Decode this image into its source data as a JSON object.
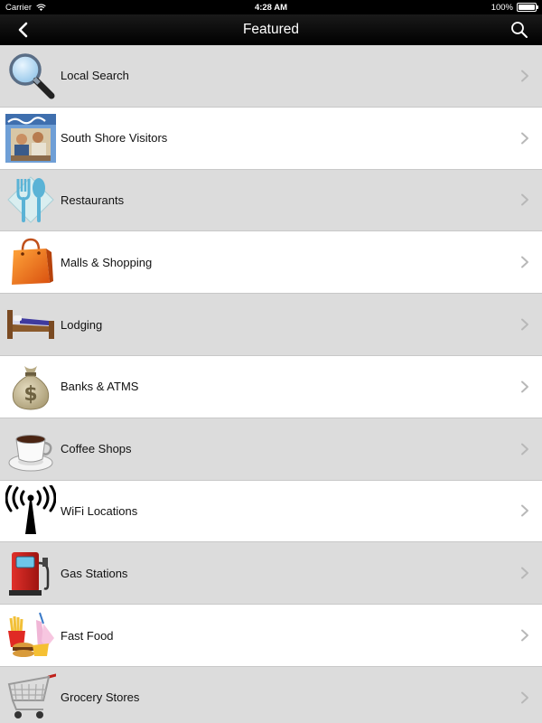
{
  "status": {
    "carrier": "Carrier",
    "time": "4:28 AM",
    "battery": "100%",
    "battery_level": 1.0
  },
  "nav": {
    "title": "Featured",
    "back_icon": "chevron-left-icon",
    "search_icon": "search-icon"
  },
  "items": [
    {
      "label": "Local Search",
      "icon": "magnifying-glass-icon"
    },
    {
      "label": "South Shore Visitors",
      "icon": "magazine-cover-icon"
    },
    {
      "label": "Restaurants",
      "icon": "fork-spoon-icon"
    },
    {
      "label": "Malls & Shopping",
      "icon": "shopping-bag-icon"
    },
    {
      "label": "Lodging",
      "icon": "bed-icon"
    },
    {
      "label": "Banks & ATMS",
      "icon": "money-bag-icon"
    },
    {
      "label": "Coffee Shops",
      "icon": "coffee-cup-icon"
    },
    {
      "label": "WiFi Locations",
      "icon": "wifi-tower-icon"
    },
    {
      "label": "Gas Stations",
      "icon": "gas-pump-icon"
    },
    {
      "label": "Fast Food",
      "icon": "fast-food-icon"
    },
    {
      "label": "Grocery Stores",
      "icon": "shopping-cart-icon"
    }
  ],
  "colors": {
    "row_gray": "#dcdcdc",
    "row_white": "#ffffff",
    "navbar": "#000000",
    "chevron": "#b8b8b8"
  }
}
